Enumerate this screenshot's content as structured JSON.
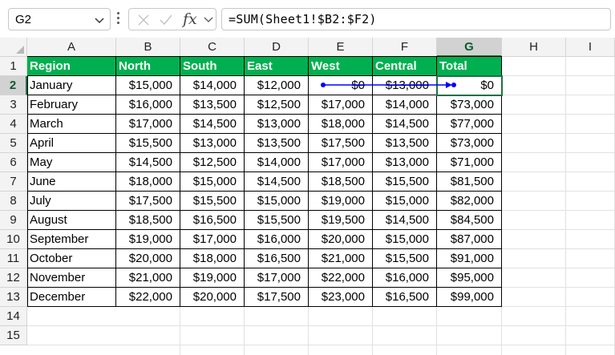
{
  "name_box": {
    "value": "G2"
  },
  "formula_bar": {
    "fx_label": "fx",
    "formula": "=SUM(Sheet1!$B2:$F2)"
  },
  "columns": [
    "A",
    "B",
    "C",
    "D",
    "E",
    "F",
    "G",
    "H",
    "I"
  ],
  "rows": [
    "1",
    "2",
    "3",
    "4",
    "5",
    "6",
    "7",
    "8",
    "9",
    "10",
    "11",
    "12",
    "13",
    "14",
    "15"
  ],
  "selected_cell": {
    "column": "G",
    "row": "2"
  },
  "colors": {
    "header_fill": "#00b050",
    "header_text": "#ffffff",
    "trace_arrow": "#0000ff",
    "selection": "#1e7145"
  },
  "table": {
    "headers": [
      "Region",
      "North",
      "South",
      "East",
      "West",
      "Central",
      "Total"
    ],
    "rows": [
      [
        "January",
        "$15,000",
        "$14,000",
        "$12,000",
        "$0",
        "$13,000",
        "$0"
      ],
      [
        "February",
        "$16,000",
        "$13,500",
        "$12,500",
        "$17,000",
        "$14,000",
        "$73,000"
      ],
      [
        "March",
        "$17,000",
        "$14,500",
        "$13,000",
        "$18,000",
        "$14,500",
        "$77,000"
      ],
      [
        "April",
        "$15,500",
        "$13,000",
        "$13,500",
        "$17,500",
        "$13,500",
        "$73,000"
      ],
      [
        "May",
        "$14,500",
        "$12,500",
        "$14,000",
        "$17,000",
        "$13,000",
        "$71,000"
      ],
      [
        "June",
        "$18,000",
        "$15,000",
        "$14,500",
        "$18,500",
        "$15,500",
        "$81,500"
      ],
      [
        "July",
        "$17,500",
        "$15,500",
        "$15,000",
        "$19,000",
        "$15,000",
        "$82,000"
      ],
      [
        "August",
        "$18,500",
        "$16,500",
        "$15,500",
        "$19,500",
        "$14,500",
        "$84,500"
      ],
      [
        "September",
        "$19,000",
        "$17,000",
        "$16,000",
        "$20,000",
        "$15,000",
        "$87,000"
      ],
      [
        "October",
        "$20,000",
        "$18,000",
        "$16,500",
        "$21,000",
        "$15,500",
        "$91,000"
      ],
      [
        "November",
        "$21,000",
        "$19,000",
        "$17,000",
        "$22,000",
        "$16,000",
        "$95,000"
      ],
      [
        "December",
        "$22,000",
        "$20,000",
        "$17,500",
        "$23,000",
        "$16,500",
        "$99,000"
      ]
    ]
  },
  "trace_precedents": {
    "shown": true,
    "cells": [
      "E2",
      "F2"
    ],
    "target": "G2"
  }
}
